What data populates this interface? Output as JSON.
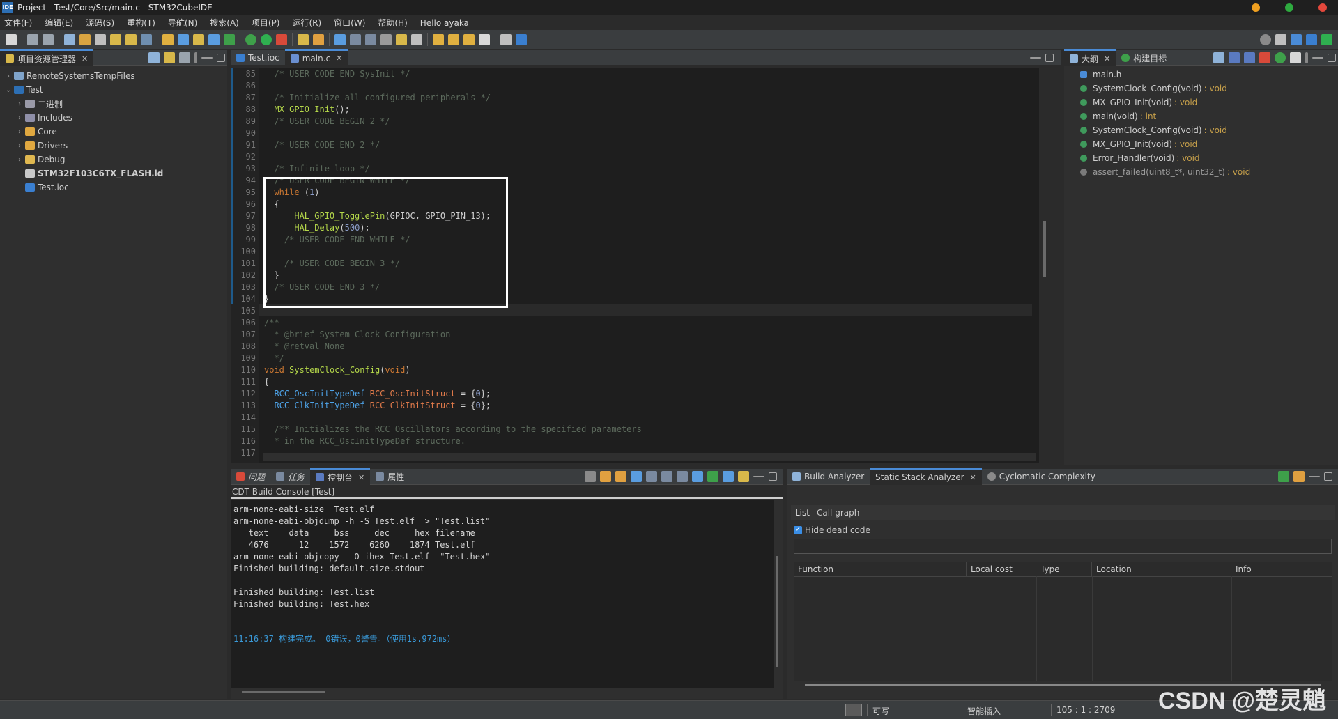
{
  "window": {
    "title": "Project - Test/Core/Src/main.c - STM32CubeIDE",
    "app_badge": "IDE"
  },
  "menu": [
    "文件(F)",
    "编辑(E)",
    "源码(S)",
    "重构(T)",
    "导航(N)",
    "搜索(A)",
    "项目(P)",
    "运行(R)",
    "窗口(W)",
    "帮助(H)",
    "Hello ayaka"
  ],
  "explorer": {
    "tab_label": "项目资源管理器",
    "items": [
      {
        "label": "RemoteSystemsTempFiles",
        "chev": "›"
      },
      {
        "label": "Test",
        "chev": "⌄"
      },
      {
        "label": "二进制",
        "chev": "›"
      },
      {
        "label": "Includes",
        "chev": "›"
      },
      {
        "label": "Core",
        "chev": "›"
      },
      {
        "label": "Drivers",
        "chev": "›"
      },
      {
        "label": "Debug",
        "chev": "›"
      },
      {
        "label": "STM32F103C6TX_FLASH.ld",
        "chev": ""
      },
      {
        "label": "Test.ioc",
        "chev": ""
      }
    ]
  },
  "editor": {
    "tabs": [
      {
        "label": "Test.ioc"
      },
      {
        "label": "main.c"
      }
    ],
    "line_numbers": [
      "85",
      "86",
      "87",
      "88",
      "89",
      "90",
      "91",
      "92",
      "93",
      "94",
      "95",
      "96",
      "97",
      "98",
      "99",
      "100",
      "101",
      "102",
      "103",
      "104",
      "105",
      "106",
      "107",
      "108",
      "109",
      "110",
      "111",
      "112",
      "113",
      "114",
      "115",
      "116",
      "117"
    ],
    "lines": [
      "  /* USER CODE END SysInit */",
      "",
      "  /* Initialize all configured peripherals */",
      "  MX_GPIO_Init();",
      "  /* USER CODE BEGIN 2 */",
      "",
      "  /* USER CODE END 2 */",
      "",
      "  /* Infinite loop */",
      "  /* USER CODE BEGIN WHILE */",
      "  while (1)",
      "  {",
      "      HAL_GPIO_TogglePin(GPIOC, GPIO_PIN_13);",
      "      HAL_Delay(500);",
      "    /* USER CODE END WHILE */",
      "",
      "    /* USER CODE BEGIN 3 */",
      "  }",
      "  /* USER CODE END 3 */",
      "}",
      "",
      "/**",
      "  * @brief System Clock Configuration",
      "  * @retval None",
      "  */",
      "void SystemClock_Config(void)",
      "{",
      "  RCC_OscInitTypeDef RCC_OscInitStruct = {0};",
      "  RCC_ClkInitTypeDef RCC_ClkInitStruct = {0};",
      "",
      "  /** Initializes the RCC Oscillators according to the specified parameters",
      "  * in the RCC_OscInitTypeDef structure.",
      ""
    ]
  },
  "outline": {
    "tabs": [
      {
        "label": "大纲"
      },
      {
        "label": "构建目标"
      }
    ],
    "items": [
      {
        "name": "main.h",
        "ret": "",
        "color": "#4a8bd6"
      },
      {
        "name": "SystemClock_Config(void)",
        "ret": ": void",
        "color": "#3f9a5c"
      },
      {
        "name": "MX_GPIO_Init(void)",
        "ret": ": void",
        "color": "#3f9a5c"
      },
      {
        "name": "main(void)",
        "ret": ": int",
        "color": "#3f9a5c"
      },
      {
        "name": "SystemClock_Config(void)",
        "ret": ": void",
        "color": "#3f9a5c"
      },
      {
        "name": "MX_GPIO_Init(void)",
        "ret": ": void",
        "color": "#3f9a5c"
      },
      {
        "name": "Error_Handler(void)",
        "ret": ": void",
        "color": "#3f9a5c"
      },
      {
        "name": "assert_failed(uint8_t*, uint32_t)",
        "ret": ": void",
        "color": "#7a7a7a"
      }
    ]
  },
  "console": {
    "tabs": [
      {
        "label": "问题"
      },
      {
        "label": "任务"
      },
      {
        "label": "控制台"
      },
      {
        "label": "属性"
      }
    ],
    "header": "CDT Build Console [Test]",
    "lines": [
      "arm-none-eabi-size  Test.elf",
      "arm-none-eabi-objdump -h -S Test.elf  > \"Test.list\"",
      "   text    data     bss     dec     hex filename",
      "   4676      12    1572    6260    1874 Test.elf",
      "arm-none-eabi-objcopy  -O ihex Test.elf  \"Test.hex\"",
      "Finished building: default.size.stdout",
      "",
      "Finished building: Test.list",
      "Finished building: Test.hex"
    ],
    "result": "11:16:37 构建完成。 0错误，0警告。（使用1s.972ms）"
  },
  "analyzer": {
    "tabs": [
      {
        "label": "Build Analyzer"
      },
      {
        "label": "Static Stack Analyzer"
      },
      {
        "label": "Cyclomatic Complexity"
      }
    ],
    "subtabs": [
      {
        "label": "List"
      },
      {
        "label": "Call graph"
      }
    ],
    "hide_dead_code": "Hide dead code",
    "columns": [
      "Function",
      "Local cost",
      "Type",
      "Location",
      "Info"
    ]
  },
  "status": {
    "writable": "可写",
    "insert": "智能插入",
    "position": "105 : 1 : 2709"
  },
  "watermark": "CSDN @楚灵魈"
}
